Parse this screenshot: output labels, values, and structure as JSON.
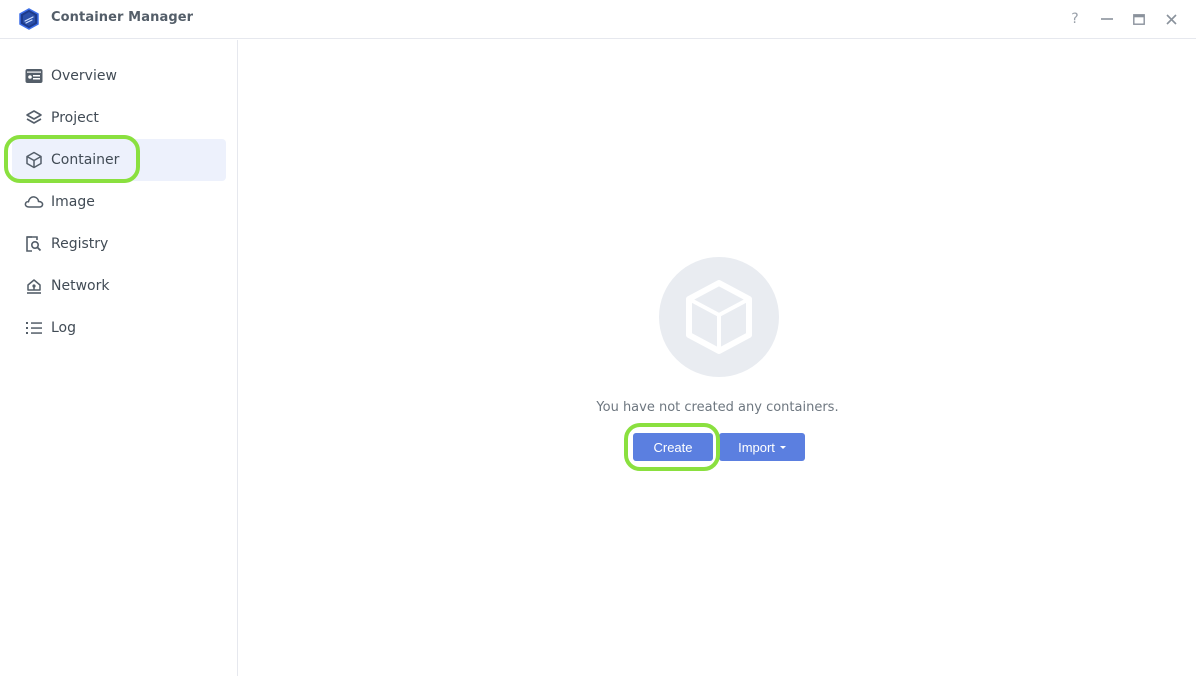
{
  "window": {
    "title": "Container Manager",
    "controls": {
      "help": "?",
      "minimize": "minimize-icon",
      "maximize": "maximize-icon",
      "close": "close-icon"
    }
  },
  "sidebar": {
    "active": "Container",
    "items": [
      {
        "label": "Overview",
        "icon": "overview-card-icon"
      },
      {
        "label": "Project",
        "icon": "layers-icon"
      },
      {
        "label": "Container",
        "icon": "cube-icon"
      },
      {
        "label": "Image",
        "icon": "cloud-icon"
      },
      {
        "label": "Registry",
        "icon": "registry-search-icon"
      },
      {
        "label": "Network",
        "icon": "network-home-icon"
      },
      {
        "label": "Log",
        "icon": "list-icon"
      }
    ]
  },
  "main": {
    "empty_state": {
      "icon": "cube-icon",
      "message": "You have not created any containers."
    },
    "buttons": {
      "create": "Create",
      "import": "Import"
    }
  },
  "colors": {
    "accent": "#5b7fe0",
    "active_nav_bg": "#edf1fc",
    "highlight": "#8ae03f"
  }
}
